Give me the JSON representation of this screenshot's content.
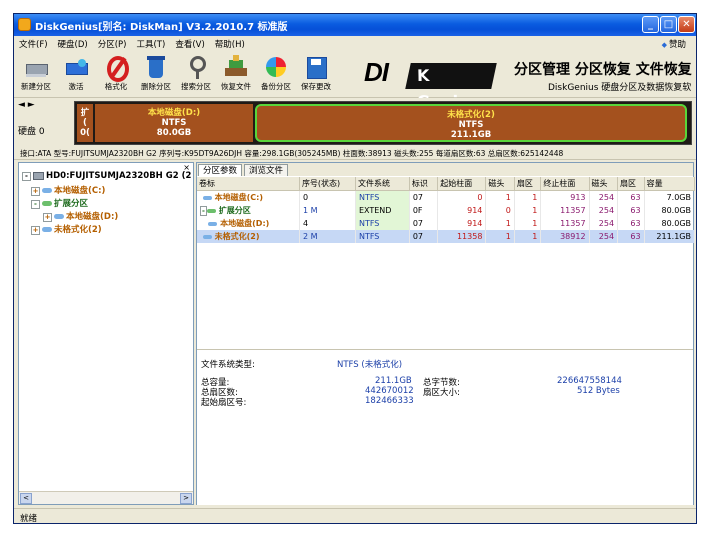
{
  "window": {
    "title": "DiskGenius[别名: DiskMan] V3.2.2010.7 标准版",
    "controls": [
      "_",
      "□",
      "✕"
    ]
  },
  "menu": {
    "items": [
      "文件(F)",
      "硬盘(D)",
      "分区(P)",
      "工具(T)",
      "查看(V)",
      "帮助(H)"
    ],
    "help": "赞助"
  },
  "toolbar": {
    "buttons": [
      {
        "label": "新建分区",
        "icon": "new-partition-icon"
      },
      {
        "label": "激活",
        "icon": "activate-icon"
      },
      {
        "label": "格式化",
        "icon": "format-icon"
      },
      {
        "label": "删除分区",
        "icon": "delete-partition-icon"
      },
      {
        "label": "搜索分区",
        "icon": "search-partition-icon"
      },
      {
        "label": "恢复文件",
        "icon": "recover-files-icon"
      },
      {
        "label": "备份分区",
        "icon": "backup-partition-icon"
      },
      {
        "label": "保存更改",
        "icon": "save-changes-icon"
      }
    ],
    "brand_logo": "DI",
    "brand_logo2": "Genius",
    "brand_logo_k": "K",
    "slogan": "分区管理 分区恢复 文件恢复",
    "subslogan": "DiskGenius 硬盘分区及数据恢复软"
  },
  "diskmap": {
    "nav": "◄ ►",
    "disk_label": "硬盘 0",
    "segments": [
      {
        "name": "本地磁盘(D:)",
        "fs": "NTFS",
        "size": "80.0GB"
      },
      {
        "name": "未格式化(2)",
        "fs": "NTFS",
        "size": "211.1GB"
      }
    ],
    "small_seg": [
      "扩",
      "(",
      "0("
    ]
  },
  "infobar": "接口:ATA  型号:FUJITSUMJA2320BH G2  序列号:K95DT9A26DJH  容量:298.1GB(305245MB)  柱面数:38913  磁头数:255  每道扇区数:63  总扇区数:625142448",
  "tree": {
    "close": "×",
    "items": [
      {
        "label": "HD0:FUJITSUMJA2320BH G2 (2",
        "exp": "-"
      },
      {
        "label": "本地磁盘(C:)",
        "exp": "+"
      },
      {
        "label": "扩展分区",
        "exp": "-"
      },
      {
        "label": "本地磁盘(D:)",
        "exp": "+"
      },
      {
        "label": "未格式化(2)",
        "exp": "+"
      }
    ],
    "scroll_left": "<",
    "scroll_right": ">"
  },
  "tabs": [
    "分区参数",
    "浏览文件"
  ],
  "table": {
    "headers": [
      "卷标",
      "序号(状态)",
      "文件系统",
      "标识",
      "起始柱面",
      "磁头",
      "扇区",
      "终止柱面",
      "磁头",
      "扇区",
      "容量"
    ],
    "rows": [
      {
        "name": "本地磁盘(C:)",
        "idx": "0",
        "fs": "NTFS",
        "id": "07",
        "sc": "0",
        "sh": "1",
        "ss": "1",
        "ec": "913",
        "eh": "254",
        "es": "63",
        "cap": "7.0GB"
      },
      {
        "name": "扩展分区",
        "idx": "1 M",
        "fs": "EXTEND",
        "id": "0F",
        "sc": "914",
        "sh": "0",
        "ss": "1",
        "ec": "11357",
        "eh": "254",
        "es": "63",
        "cap": "80.0GB"
      },
      {
        "name": "本地磁盘(D:)",
        "idx": "4",
        "fs": "NTFS",
        "id": "07",
        "sc": "914",
        "sh": "1",
        "ss": "1",
        "ec": "11357",
        "eh": "254",
        "es": "63",
        "cap": "80.0GB"
      },
      {
        "name": "未格式化(2)",
        "idx": "2 M",
        "fs": "NTFS",
        "id": "07",
        "sc": "11358",
        "sh": "1",
        "ss": "1",
        "ec": "38912",
        "eh": "254",
        "es": "63",
        "cap": "211.1GB"
      }
    ]
  },
  "details": {
    "fs_type_label": "文件系统类型:",
    "fs_type_value": "NTFS (未格式化)",
    "total_cap_label": "总容量:",
    "total_cap_value": "211.1GB",
    "total_bytes_label": "总字节数:",
    "total_bytes_value": "226647558144",
    "total_sectors_label": "总扇区数:",
    "total_sectors_value": "442670012",
    "sector_size_label": "扇区大小:",
    "sector_size_value": "512 Bytes",
    "start_sector_label": "起始扇区号:",
    "start_sector_value": "182466333"
  },
  "status": "就绪"
}
